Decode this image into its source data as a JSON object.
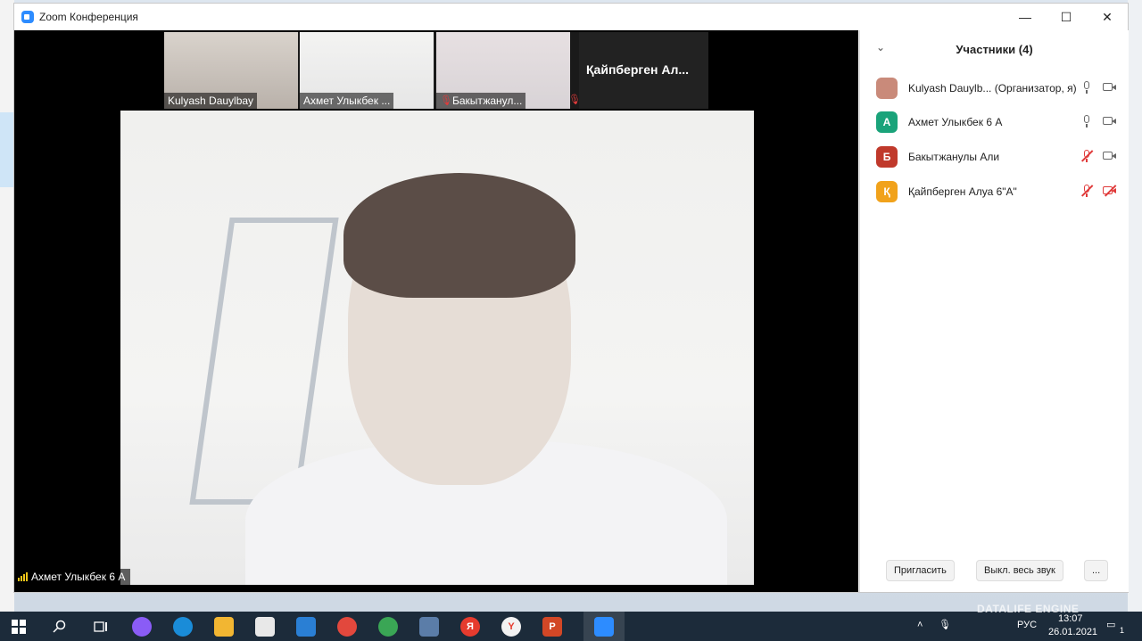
{
  "window": {
    "title": "Zoom Конференция",
    "minimize": "—",
    "maximize": "☐",
    "close": "✕"
  },
  "thumbnails": [
    {
      "name": "Kulyash Dauylbay",
      "active": false,
      "muted": false
    },
    {
      "name": "Ахмет Улыкбек ...",
      "active": true,
      "muted": false
    },
    {
      "name": "Бакытжанул...",
      "active": false,
      "muted": true
    }
  ],
  "name_tile": {
    "label": "Қайпберген  Ал..."
  },
  "main_video": {
    "speaker": "Ахмет Улыкбек 6 А"
  },
  "panel": {
    "title": "Участники (4)",
    "participants": [
      {
        "initial": "",
        "name": "Kulyash Dauylb...  (Организатор, я)",
        "color": "#c98a7a",
        "mic_muted": false,
        "cam_off": false
      },
      {
        "initial": "А",
        "name": "Ахмет Улыкбек 6 А",
        "color": "#1aa37a",
        "mic_muted": false,
        "cam_off": false
      },
      {
        "initial": "Б",
        "name": "Бакытжанулы Али",
        "color": "#c0392b",
        "mic_muted": true,
        "cam_off": false
      },
      {
        "initial": "Қ",
        "name": "Қайпберген Алуа 6\"А\"",
        "color": "#f1a21b",
        "mic_muted": true,
        "cam_off": true
      }
    ],
    "invite_button": "Пригласить",
    "mute_all_button": "Выкл. весь звук",
    "more_button": "..."
  },
  "taskbar": {
    "language": "РУС",
    "time": "13:07",
    "date": "26.01.2021",
    "notification_count": "1",
    "watermark": "DATALIFE ENGINE"
  },
  "colors": {
    "zoom_blue": "#2d8cff",
    "active_border": "#5fae3f",
    "muted_red": "#e03b3b",
    "taskbar": "#1c2b3a"
  }
}
